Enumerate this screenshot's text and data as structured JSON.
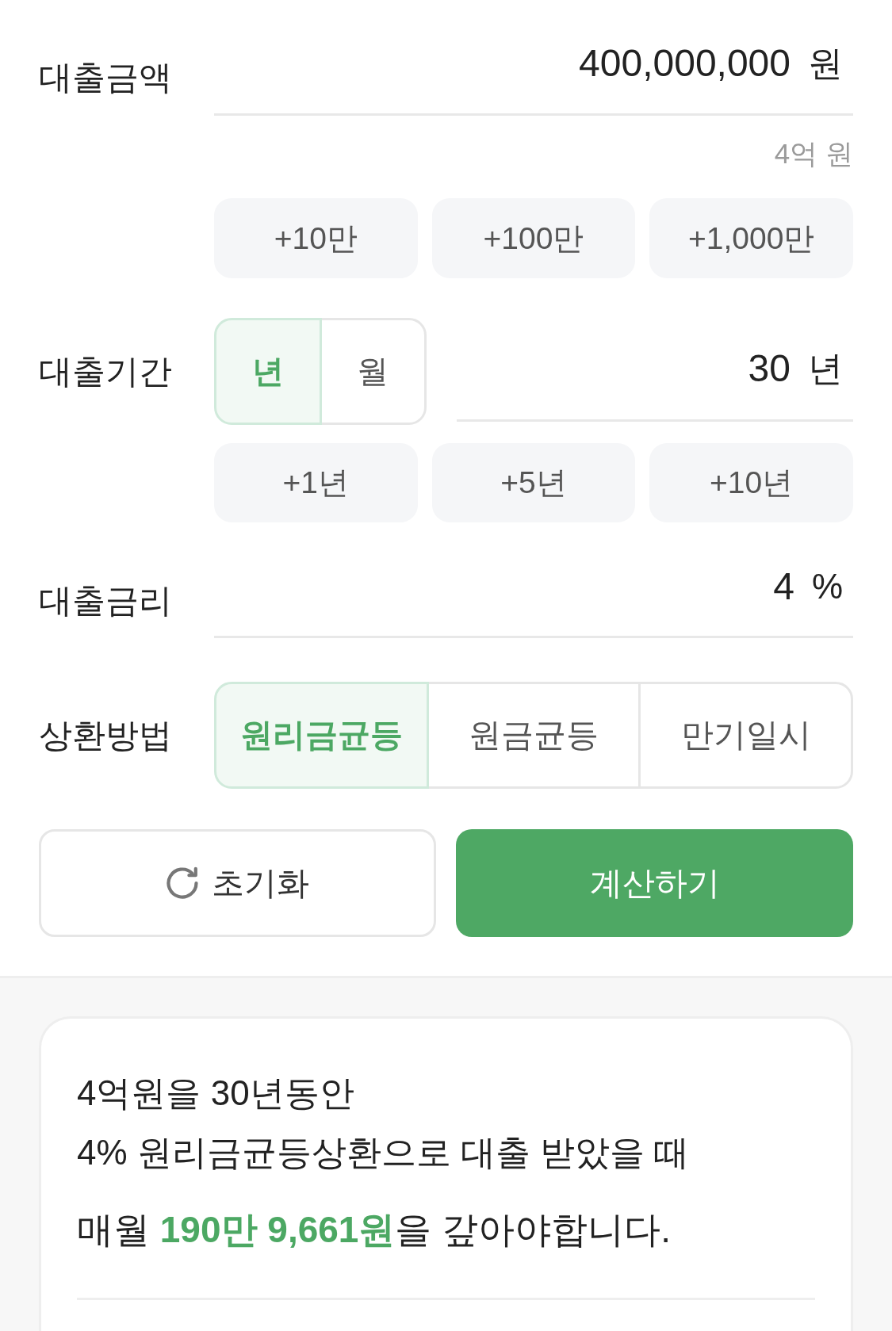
{
  "loan_amount": {
    "label": "대출금액",
    "value": "400,000,000",
    "unit": "원",
    "hint": "4억 원",
    "quick_buttons": [
      "+10만",
      "+100만",
      "+1,000만"
    ]
  },
  "loan_period": {
    "label": "대출기간",
    "unit_tabs": [
      {
        "label": "년",
        "selected": true
      },
      {
        "label": "월",
        "selected": false
      }
    ],
    "value": "30",
    "unit": "년",
    "quick_buttons": [
      "+1년",
      "+5년",
      "+10년"
    ]
  },
  "interest_rate": {
    "label": "대출금리",
    "value": "4",
    "unit": "%"
  },
  "repayment_method": {
    "label": "상환방법",
    "options": [
      {
        "label": "원리금균등",
        "selected": true
      },
      {
        "label": "원금균등",
        "selected": false
      },
      {
        "label": "만기일시",
        "selected": false
      }
    ]
  },
  "actions": [
    {
      "kind": "reset",
      "label": "초기화"
    },
    {
      "kind": "calculate",
      "label": "계산하기"
    }
  ],
  "result": {
    "summary_lines": [
      "4억원을 30년동안",
      "4% 원리금균등상환으로 대출 받았을 때"
    ],
    "payment_sentence": "매월 **190만 9,661원**을 갚아야합니다."
  }
}
